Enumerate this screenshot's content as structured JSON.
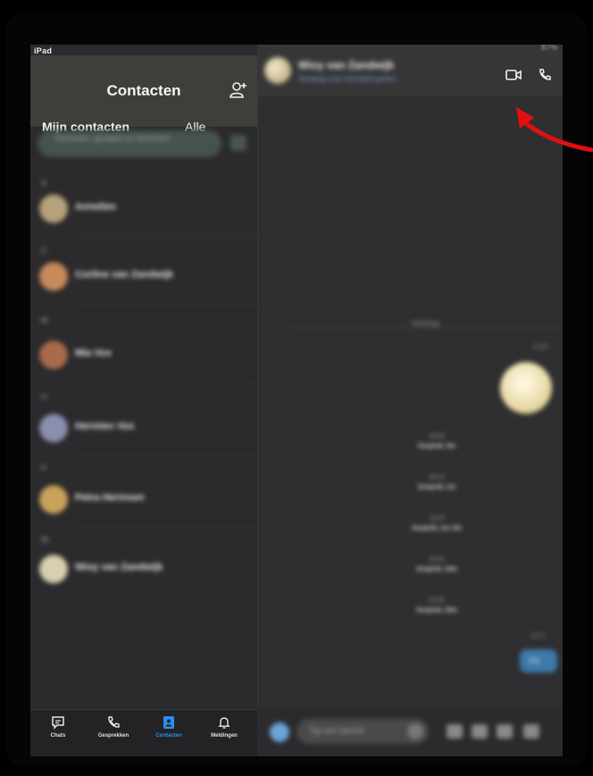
{
  "status_bar": {
    "device": "iPad",
    "battery": "87%"
  },
  "contacts_panel": {
    "title": "Contacten",
    "segments": {
      "mine": "Mijn contacten",
      "all": "Alle"
    },
    "search_placeholder": "Personen, groepen en berichten",
    "contacts": [
      {
        "letter": "A",
        "name": "Annelies",
        "color": "#b5a27c"
      },
      {
        "letter": "C",
        "name": "Corline van Zandwijk",
        "color": "#c98a5a"
      },
      {
        "letter": "M",
        "name": "Mia Vos",
        "color": "#a86b4a"
      },
      {
        "letter": "H",
        "name": "Hermien Vos",
        "color": "#8a8fb0"
      },
      {
        "letter": "P",
        "name": "Petra Hermsen",
        "color": "#c9a35a"
      },
      {
        "letter": "W",
        "name": "Wioy van Zandwijk",
        "color": "#d8cfb0"
      }
    ]
  },
  "tab_bar": {
    "tabs": [
      {
        "label": "Chats",
        "icon": "chat-icon"
      },
      {
        "label": "Gesprekken",
        "icon": "phone-icon"
      },
      {
        "label": "Contacten",
        "icon": "contacts-icon",
        "active": true
      },
      {
        "label": "Meldingen",
        "icon": "bell-icon"
      }
    ],
    "active_color": "#2d8cf0"
  },
  "chat": {
    "contact_name": "Wioy van Zandwijk",
    "subtitle": "Vandaag voor het laatst gezien",
    "date_label": "Vandaag",
    "emoji_time": "12:45",
    "call_logs": [
      {
        "time": "16:05",
        "label": "Gesprek, 3m"
      },
      {
        "time": "16:10",
        "label": "Gesprek, 1m"
      },
      {
        "time": "16:25",
        "label": "Gesprek, 1m 14s"
      },
      {
        "time": "16:32",
        "label": "Gesprek, 19m"
      },
      {
        "time": "22:05",
        "label": "Gesprek, 23m"
      }
    ],
    "bubble_time": "22:17",
    "bubble_text": "Hoi",
    "compose_placeholder": "Typ een bericht"
  },
  "annotation": {
    "arrow_color": "#e01010"
  }
}
